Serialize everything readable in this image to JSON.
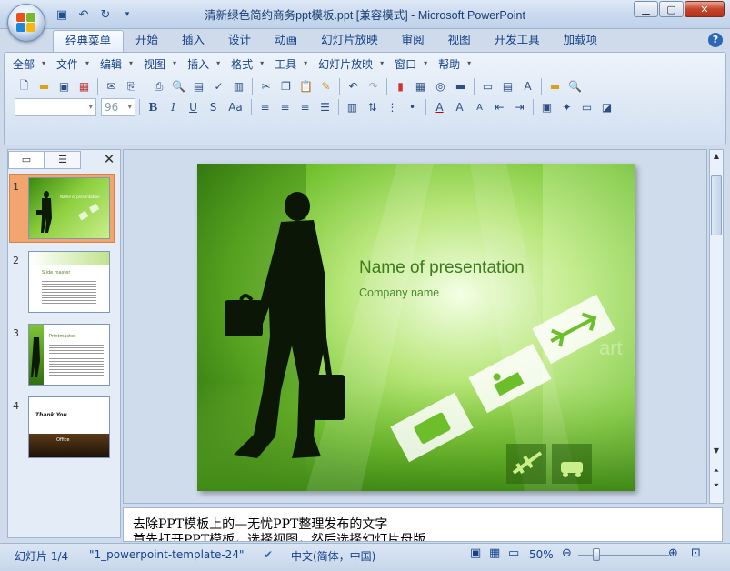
{
  "window": {
    "title": "清新绿色简约商务ppt模板.ppt [兼容模式] - Microsoft PowerPoint"
  },
  "tabs": [
    {
      "label": "经典菜单",
      "active": true
    },
    {
      "label": "开始"
    },
    {
      "label": "插入"
    },
    {
      "label": "设计"
    },
    {
      "label": "动画"
    },
    {
      "label": "幻灯片放映"
    },
    {
      "label": "审阅"
    },
    {
      "label": "视图"
    },
    {
      "label": "开发工具"
    },
    {
      "label": "加载项"
    }
  ],
  "menubar": [
    "全部",
    "文件",
    "编辑",
    "视图",
    "插入",
    "格式",
    "工具",
    "幻灯片放映",
    "窗口",
    "帮助"
  ],
  "format": {
    "font_size": "96"
  },
  "thumbnails": [
    {
      "num": "1",
      "title": "Name of presentation",
      "selected": true
    },
    {
      "num": "2",
      "title": "Slide master"
    },
    {
      "num": "3",
      "title": "Printmaster"
    },
    {
      "num": "4",
      "title": "Thank You",
      "footer": "Office"
    }
  ],
  "slide": {
    "title": "Name of presentation",
    "subtitle": "Company  name",
    "watermark": "art"
  },
  "notes": {
    "line1": "去除PPT模板上的—无忧PPT整理发布的文字",
    "line2": "首先打开PPT模板，选择视图，然后选择幻灯片母版"
  },
  "status": {
    "slide_info": "幻灯片 1/4",
    "theme": "\"1_powerpoint-template-24\"",
    "language": "中文(简体，中国)",
    "zoom": "50%"
  }
}
